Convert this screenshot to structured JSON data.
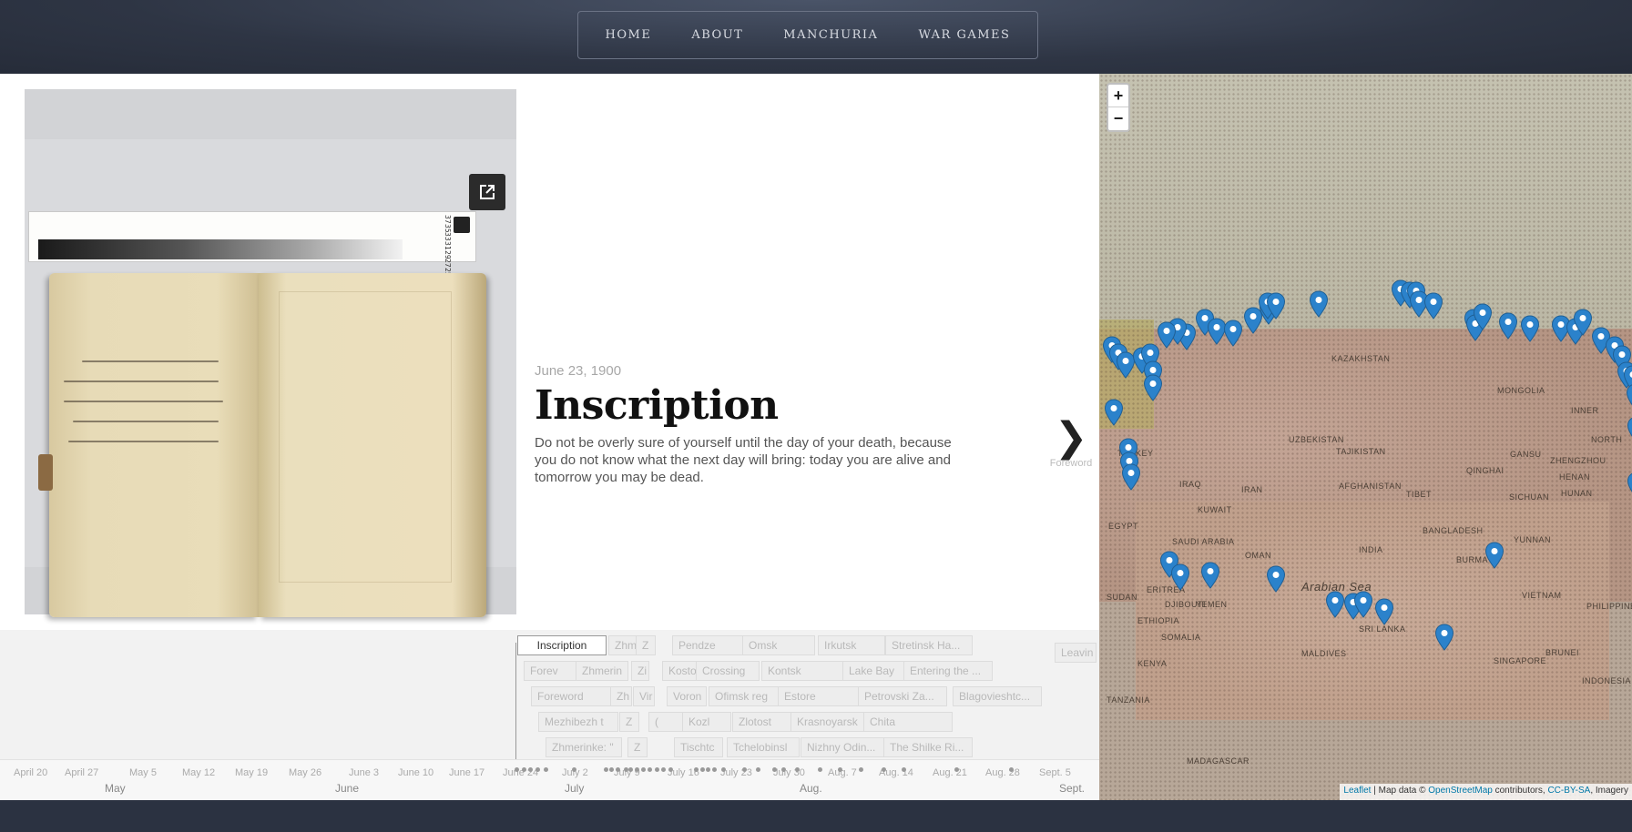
{
  "nav": {
    "items": [
      "HOME",
      "ABOUT",
      "MANCHURIA",
      "WAR GAMES"
    ]
  },
  "viewer": {
    "expand_icon": "external-link-icon",
    "zoom_out": "−",
    "zoom_reset_icon": "magnifier-icon",
    "zoom_in": "+"
  },
  "story": {
    "date": "June 23, 1900",
    "title": "Inscription",
    "body": "Do not be overly sure of yourself until the day of your death, because you do not know what the next day will bring: today you are alive and tomorrow you may be dead.",
    "next_label": "Foreword"
  },
  "map": {
    "zoom_in": "+",
    "zoom_out": "−",
    "labels": [
      "KAZAKHSTAN",
      "MONGOLIA",
      "UZBEKISTAN",
      "TAJIKISTAN",
      "AFGHANISTAN",
      "IRAN",
      "IRAQ",
      "KUWAIT",
      "TURKEY",
      "EGYPT",
      "SAUDI ARABIA",
      "OMAN",
      "YEMEN",
      "SUDAN",
      "ERITREA",
      "DJIBOUTI",
      "ETHIOPIA",
      "SOMALIA",
      "KENYA",
      "TANZANIA",
      "MADAGASCAR",
      "INDIA",
      "TIBET",
      "QINGHAI",
      "GANSU",
      "SICHUAN",
      "YUNNAN",
      "BURMA",
      "VIETNAM",
      "PHILIPPINES",
      "INDONESIA",
      "BRUNEI",
      "SINGAPORE",
      "MALDIVES",
      "SRI LANKA",
      "BANGLADESH",
      "HENAN",
      "HUNAN",
      "NORTH",
      "INNER",
      "ZHENGZHOU",
      "Arabian Sea"
    ],
    "attribution": {
      "leaflet": "Leaflet",
      "sep1": " | Map data © ",
      "osm": "OpenStreetMap",
      "sep2": " contributors, ",
      "license": "CC-BY-SA",
      "sep3": ", Imagery"
    },
    "pin_color": "#2b82cb"
  },
  "timeline": {
    "active_card": "Inscription",
    "cards": [
      "Zhmerin",
      "Z",
      "Pendze",
      "Omsk",
      "Irkutsk",
      "Stretinsk Ha...",
      "Forev",
      "Zhmerin",
      "Zi",
      "Kosto",
      "Crossing",
      "Kontsk",
      "Lake Bay",
      "Entering the ...",
      "Foreword",
      "Zh",
      "Vir",
      "Voron",
      "Ofimsk reg",
      "Estore",
      "Petrovski Za...",
      "Blagovieshtc...",
      "Mezhibezh t",
      "Z",
      "(",
      "Kozl",
      "Zlotost",
      "Krasnoyarsk",
      "Chita",
      "Zhmerinke: \"",
      "Z",
      "Tischtc",
      "Tchelobinsl",
      "Nizhny Odin...",
      "The Shilke Ri...",
      "Leavin"
    ],
    "ticks": [
      "April 20",
      "April 27",
      "May 5",
      "May 12",
      "May 19",
      "May 26",
      "June 3",
      "June 10",
      "June 17",
      "June 24",
      "July 2",
      "July 9",
      "July 16",
      "July 23",
      "July 30",
      "Aug. 7",
      "Aug. 14",
      "Aug. 21",
      "Aug. 28",
      "Sept. 5"
    ],
    "months": [
      "May",
      "June",
      "July",
      "Aug.",
      "Sept."
    ]
  }
}
